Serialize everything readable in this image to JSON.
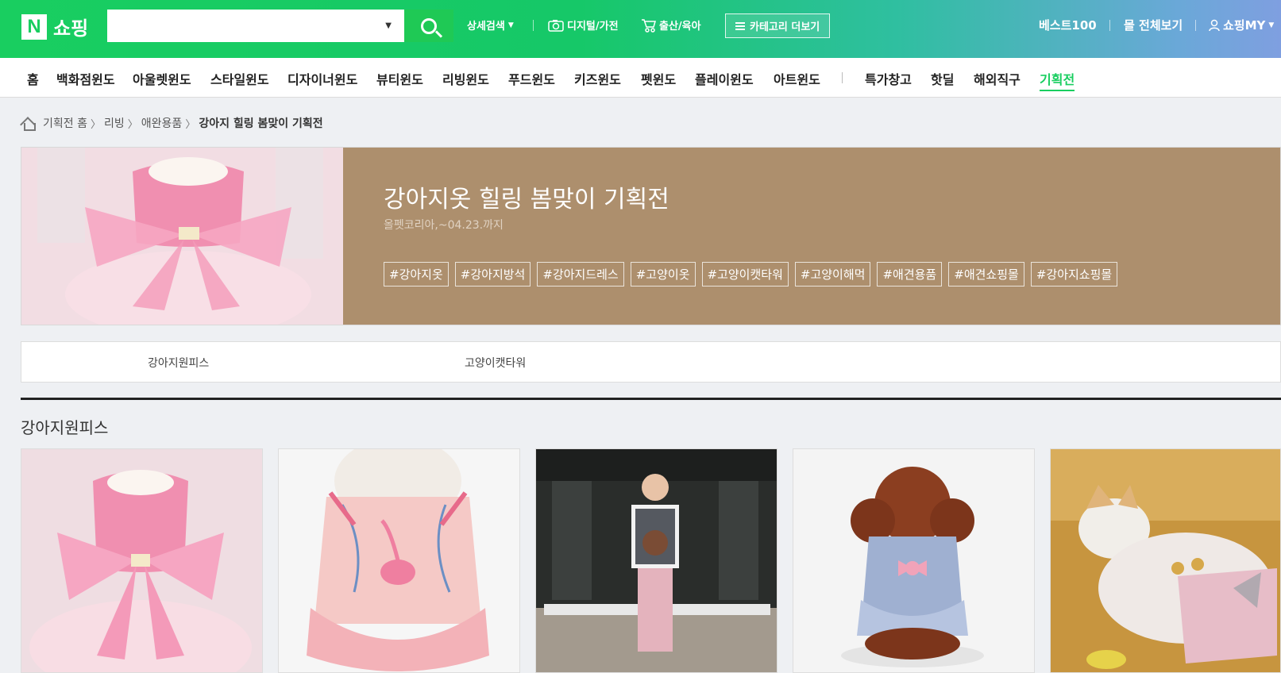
{
  "header": {
    "logo_letter": "N",
    "logo_text": "쇼핑",
    "search_placeholder": "",
    "search_value": "",
    "detail_search": "상세검색",
    "digital": "디지털/가전",
    "baby": "출산/육아",
    "category_more": "카테고리 더보기",
    "best100": "베스트100",
    "mall_all": "몰 전체보기",
    "my_shopping": "쇼핑MY"
  },
  "nav": {
    "items": [
      "홈",
      "백화점윈도",
      "아울렛윈도",
      "스타일윈도",
      "디자이너윈도",
      "뷰티윈도",
      "리빙윈도",
      "푸드윈도",
      "키즈윈도",
      "펫윈도",
      "플레이윈도",
      "아트윈도"
    ],
    "items2": [
      "특가창고",
      "핫딜",
      "해외직구",
      "기획전"
    ],
    "active": "기획전"
  },
  "breadcrumb": {
    "home": "기획전 홈",
    "c1": "리빙",
    "c2": "애완용품",
    "current": "강아지 힐링 봄맞이 기획전"
  },
  "banner": {
    "title": "강아지옷 힐링 봄맞이 기획전",
    "subtitle": "올펫코리아,~04.23.까지",
    "tags": [
      "#강아지옷",
      "#강아지방석",
      "#강아지드레스",
      "#고양이옷",
      "#고양이캣타워",
      "#고양이해먹",
      "#애견용품",
      "#애견쇼핑몰",
      "#강아지쇼핑몰"
    ],
    "bg_color": "#ad8f6d"
  },
  "tabs": [
    "강아지원피스",
    "고양이캣타워"
  ],
  "section": {
    "title": "강아지원피스"
  },
  "colors": {
    "brand_green": "#19ce60",
    "banner_brown": "#ad8f6d"
  }
}
